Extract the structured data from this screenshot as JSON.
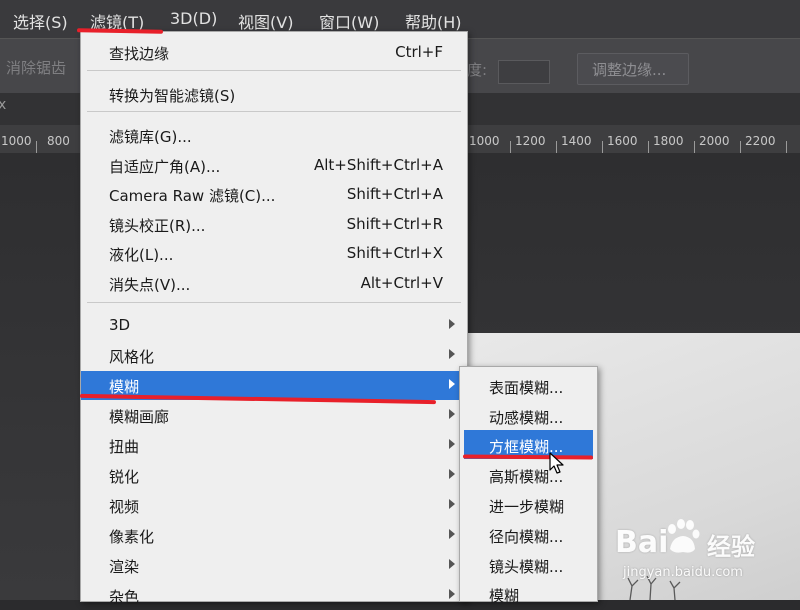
{
  "menubar": {
    "items": [
      {
        "label": "选择(S)"
      },
      {
        "label": "滤镜(T)"
      },
      {
        "label": "3D(D)"
      },
      {
        "label": "视图(V)"
      },
      {
        "label": "窗口(W)"
      },
      {
        "label": "帮助(H)"
      }
    ]
  },
  "options_bar": {
    "antialias_label": "消除锯齿",
    "degree_label": "度:",
    "refine_button": "调整边缘..."
  },
  "tab": {
    "close_glyph": "x"
  },
  "ruler": {
    "labels": [
      "1000",
      "800",
      "1000",
      "1200",
      "1400",
      "1600",
      "1800",
      "2000",
      "2200"
    ]
  },
  "filter_menu": {
    "items": [
      {
        "label": "查找边缘",
        "shortcut": "Ctrl+F"
      },
      {
        "label": "转换为智能滤镜(S)",
        "shortcut": ""
      },
      {
        "label": "滤镜库(G)...",
        "shortcut": ""
      },
      {
        "label": "自适应广角(A)...",
        "shortcut": "Alt+Shift+Ctrl+A"
      },
      {
        "label": "Camera Raw 滤镜(C)...",
        "shortcut": "Shift+Ctrl+A"
      },
      {
        "label": "镜头校正(R)...",
        "shortcut": "Shift+Ctrl+R"
      },
      {
        "label": "液化(L)...",
        "shortcut": "Shift+Ctrl+X"
      },
      {
        "label": "消失点(V)...",
        "shortcut": "Alt+Ctrl+V"
      },
      {
        "label": "3D",
        "submenu": true
      },
      {
        "label": "风格化",
        "submenu": true
      },
      {
        "label": "模糊",
        "submenu": true,
        "highlighted": true
      },
      {
        "label": "模糊画廊",
        "submenu": true
      },
      {
        "label": "扭曲",
        "submenu": true
      },
      {
        "label": "锐化",
        "submenu": true
      },
      {
        "label": "视频",
        "submenu": true
      },
      {
        "label": "像素化",
        "submenu": true
      },
      {
        "label": "渲染",
        "submenu": true
      },
      {
        "label": "杂色",
        "submenu": true
      }
    ]
  },
  "blur_submenu": {
    "items": [
      {
        "label": "表面模糊..."
      },
      {
        "label": "动感模糊..."
      },
      {
        "label": "方框模糊...",
        "highlighted": true
      },
      {
        "label": "高斯模糊..."
      },
      {
        "label": "进一步模糊"
      },
      {
        "label": "径向模糊..."
      },
      {
        "label": "镜头模糊..."
      },
      {
        "label": "模糊"
      }
    ]
  },
  "watermark": {
    "brand": "Bai",
    "brand2": "经验",
    "url": "jingyan.baidu.com"
  },
  "colors": {
    "highlight": "#2f78d8",
    "annotation": "#e8202a",
    "menu_bg": "#efefef"
  }
}
